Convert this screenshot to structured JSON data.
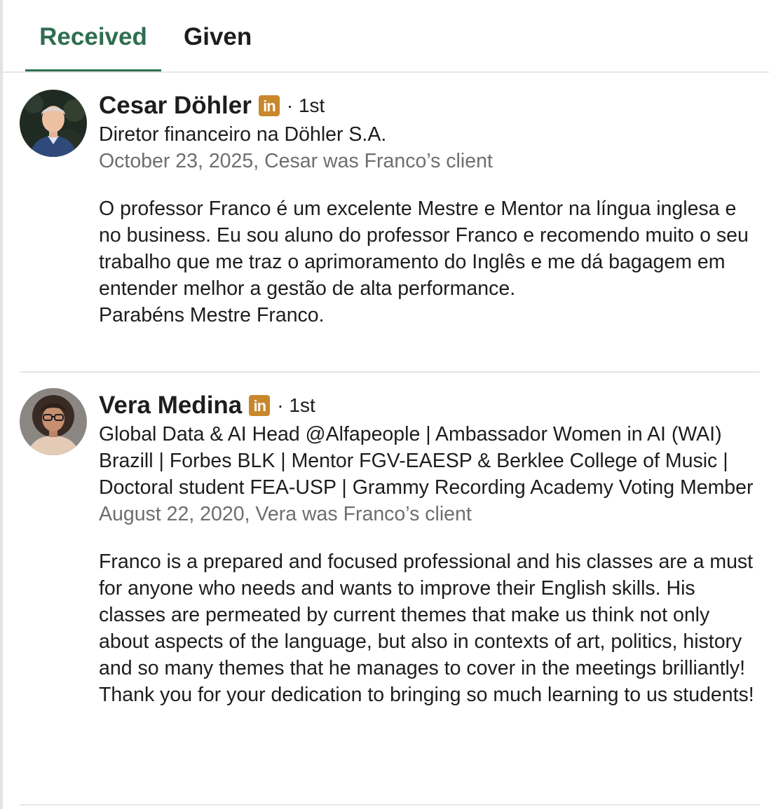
{
  "tabs": {
    "received": "Received",
    "given": "Given"
  },
  "badge_icon_text": "in",
  "colors": {
    "accent": "#2f6e50",
    "linkedin_badge": "#c9872c",
    "meta_text": "#6e6e6e"
  },
  "recommendations": [
    {
      "name": "Cesar Döhler",
      "degree": "· 1st",
      "headline": "Diretor financeiro na Döhler S.A.",
      "meta": "October 23, 2025, Cesar was Franco’s client",
      "text": "O professor Franco é um excelente Mestre e Mentor na língua inglesa e no business. Eu sou aluno do professor Franco e recomendo muito o seu trabalho que me traz o aprimoramento do Inglês e me dá bagagem em entender melhor a gestão de alta performance.\nParabéns Mestre Franco."
    },
    {
      "name": "Vera Medina",
      "degree": "· 1st",
      "headline": "Global Data & AI Head @Alfapeople | Ambassador Women in AI (WAI) Brazill | Forbes BLK | Mentor FGV-EAESP & Berklee College of Music | Doctoral student FEA-USP | Grammy Recording Academy Voting Member",
      "meta": "August 22, 2020, Vera was Franco’s client",
      "text": "Franco is a prepared and focused professional and his classes are a must for anyone who needs and wants to improve their English skills. His classes are permeated by current themes that make us think not only about aspects of the language, but also in contexts of art, politics, history and so many themes that he manages to cover in the meetings brilliantly! Thank you for your dedication to bringing so much learning to us students!"
    }
  ]
}
